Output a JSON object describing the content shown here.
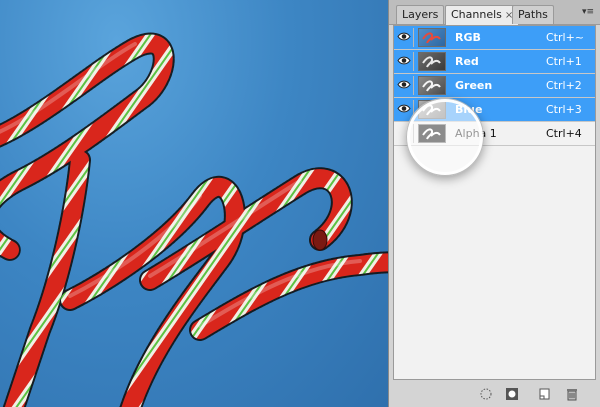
{
  "panel": {
    "tabs": [
      {
        "label": "Layers"
      },
      {
        "label": "Channels",
        "close": "×"
      },
      {
        "label": "Paths"
      }
    ],
    "menu_glyph": "▾≡",
    "channels": [
      {
        "name": "RGB",
        "shortcut": "Ctrl+~",
        "selected": true,
        "visible": true
      },
      {
        "name": "Red",
        "shortcut": "Ctrl+1",
        "selected": true,
        "visible": true
      },
      {
        "name": "Green",
        "shortcut": "Ctrl+2",
        "selected": true,
        "visible": true
      },
      {
        "name": "Blue",
        "shortcut": "Ctrl+3",
        "selected": true,
        "visible": true
      },
      {
        "name": "Alpha 1",
        "shortcut": "Ctrl+4",
        "selected": false,
        "visible": false
      }
    ],
    "footer_icons": [
      "load-selection-icon",
      "save-selection-icon",
      "new-channel-icon",
      "delete-channel-icon"
    ]
  },
  "colors": {
    "selection": "#3d9ef8",
    "candy_red": "#d9261c",
    "candy_green": "#5cc242",
    "candy_white": "#f1efe6",
    "canvas_blue": "#3d86c4"
  }
}
